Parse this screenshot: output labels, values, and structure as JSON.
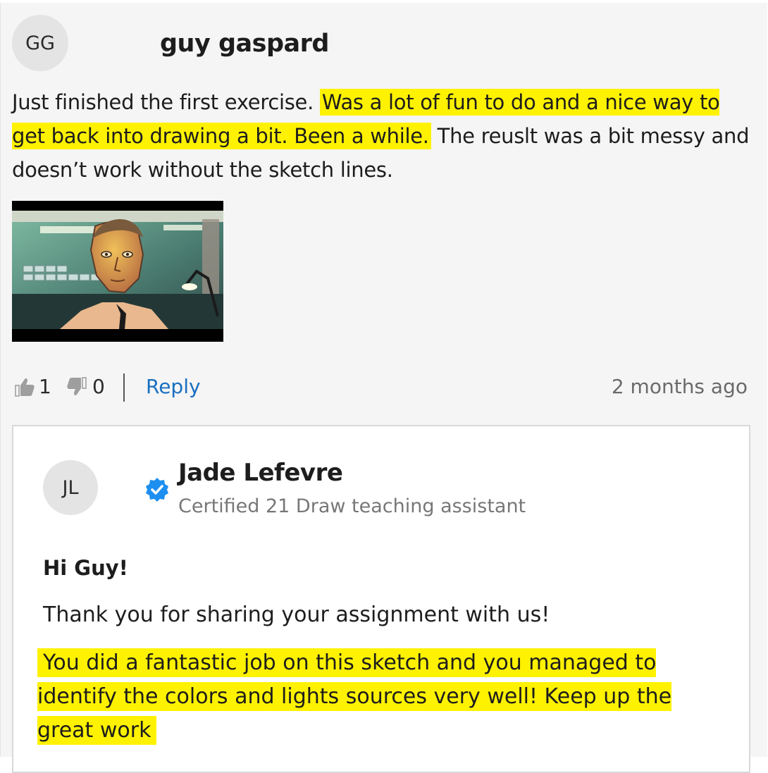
{
  "post": {
    "avatar_initials": "GG",
    "author": "guy gaspard",
    "text_before": "Just finished the first exercise. ",
    "text_highlight": "Was a lot of fun to do and a nice way to get back into drawing a bit. Been a while.",
    "text_after": " The reuslt was a bit messy and doesn’t work without the sketch lines.",
    "likes": "1",
    "dislikes": "0",
    "reply_label": "Reply",
    "timestamp": "2 months ago"
  },
  "reply": {
    "avatar_initials": "JL",
    "author": "Jade Lefevre",
    "role": "Certified 21 Draw teaching assistant",
    "greeting": "Hi Guy!",
    "thanks": "Thank you for sharing your assignment with us!",
    "praise_highlight": "You did a fantastic job on this sketch and you managed to identify the colors and lights sources very well! Keep up the great work "
  },
  "icons": {
    "like": "thumbs-up-icon",
    "dislike": "thumbs-down-icon",
    "verified": "verified-badge-icon"
  },
  "colors": {
    "highlight": "#fff200",
    "link": "#1a6fc0",
    "verified": "#1d8ff0"
  }
}
